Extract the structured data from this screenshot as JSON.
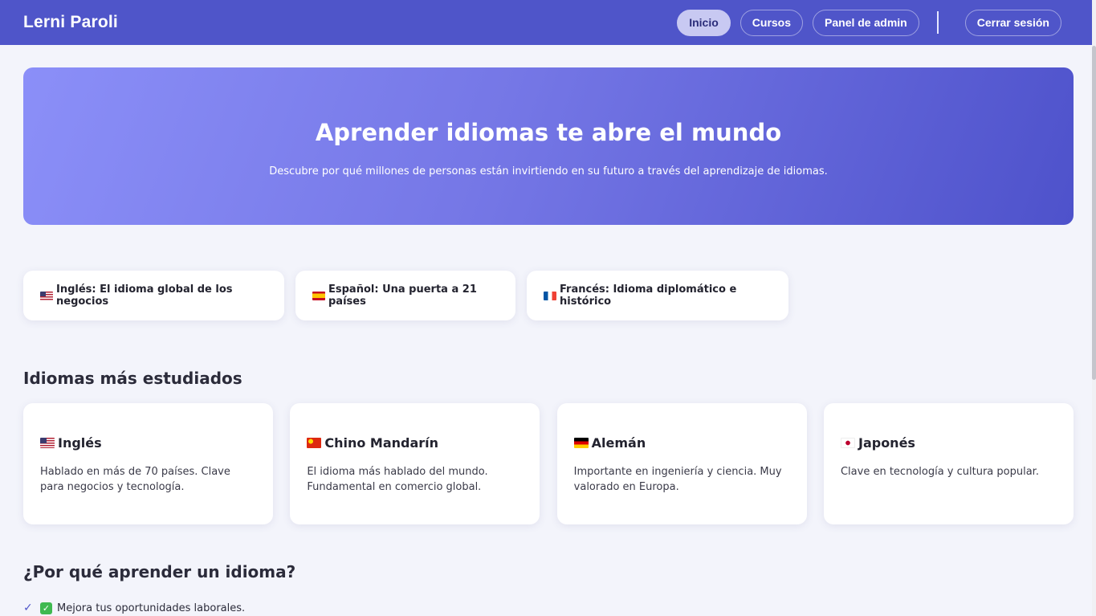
{
  "navbar": {
    "brand": "Lerni Paroli",
    "items": [
      {
        "label": "Inicio",
        "active": true
      },
      {
        "label": "Cursos",
        "active": false
      },
      {
        "label": "Panel de admin",
        "active": false
      }
    ],
    "logout_label": "Cerrar sesión"
  },
  "hero": {
    "title": "Aprender idiomas te abre el mundo",
    "subtitle": "Descubre por qué millones de personas están invirtiendo en su futuro a través del aprendizaje de idiomas."
  },
  "features": [
    {
      "flag": "us-flag-icon",
      "label": "Inglés: El idioma global de los negocios"
    },
    {
      "flag": "spain-flag-icon",
      "label": "Español: Una puerta a 21 países"
    },
    {
      "flag": "france-flag-icon",
      "label": "Francés: Idioma diplomático e histórico"
    }
  ],
  "languages_section": {
    "title": "Idiomas más estudiados",
    "cards": [
      {
        "flag": "us-flag-icon",
        "title": "Inglés",
        "description": "Hablado en más de 70 países. Clave para negocios y tecnología."
      },
      {
        "flag": "china-flag-icon",
        "title": "Chino Mandarín",
        "description": "El idioma más hablado del mundo. Fundamental en comercio global."
      },
      {
        "flag": "germany-flag-icon",
        "title": "Alemán",
        "description": "Importante en ingeniería y ciencia. Muy valorado en Europa."
      },
      {
        "flag": "japan-flag-icon",
        "title": "Japonés",
        "description": "Clave en tecnología y cultura popular."
      }
    ]
  },
  "why_section": {
    "title": "¿Por qué aprender un idioma?",
    "items": [
      {
        "icon": "check-mark-icon",
        "badge": "green-check-box-icon",
        "label": "Mejora tus oportunidades laborales."
      }
    ]
  },
  "colors": {
    "navbar": "#4f55c9",
    "hero_start": "#8b8ff8",
    "hero_end": "#4e52cb",
    "active_nav": "#c8c9f2",
    "page_background": "#f3f4fb"
  }
}
